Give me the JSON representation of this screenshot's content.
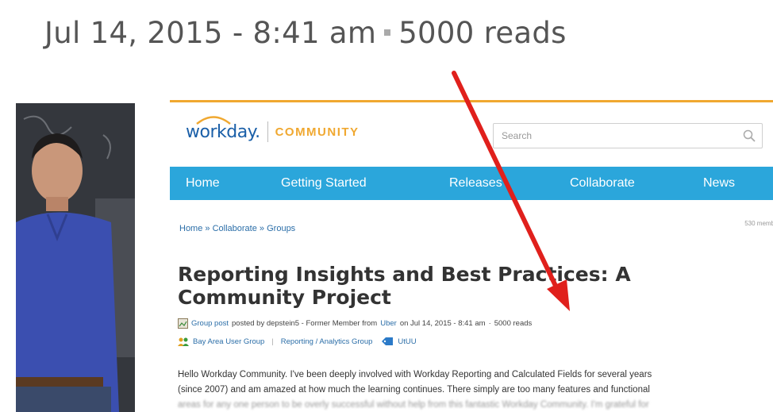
{
  "caption": {
    "date": "Jul 14, 2015 - 8:41 am",
    "reads": "5000 reads"
  },
  "header": {
    "logo_word": "workday.",
    "logo_community": "COMMUNITY",
    "search_placeholder": "Search"
  },
  "nav": {
    "items": [
      "Home",
      "Getting Started",
      "Releases",
      "Collaborate",
      "News"
    ]
  },
  "breadcrumb": {
    "home": "Home",
    "sep1": "»",
    "collaborate": "Collaborate",
    "sep2": "»",
    "groups": "Groups"
  },
  "member_count": "530 memb",
  "article": {
    "title": "Reporting Insights and Best Practices: A Community Project",
    "meta": {
      "post_type": "Group post",
      "posted_by": "posted by depstein5 - Former Member from",
      "company": "Uber",
      "date_text": "on Jul 14, 2015 - 8:41 am",
      "reads": "5000 reads"
    },
    "tags": {
      "group1": "Bay Area User Group",
      "group2": "Reporting / Analytics Group",
      "tag": "UtUU"
    },
    "body_line1": "Hello Workday Community.  I've been deeply involved with Workday Reporting and Calculated Fields for several years",
    "body_line2": "(since 2007) and am amazed at how much the learning continues.  There simply are too many features and functional",
    "body_line3": "areas for any one person to be overly successful without help from this fantastic Workday Community.  I'm grateful for"
  },
  "colors": {
    "accent_orange": "#f0a830",
    "nav_blue": "#2ba6db",
    "logo_blue": "#1a5fa8",
    "arrow_red": "#e0201c"
  }
}
